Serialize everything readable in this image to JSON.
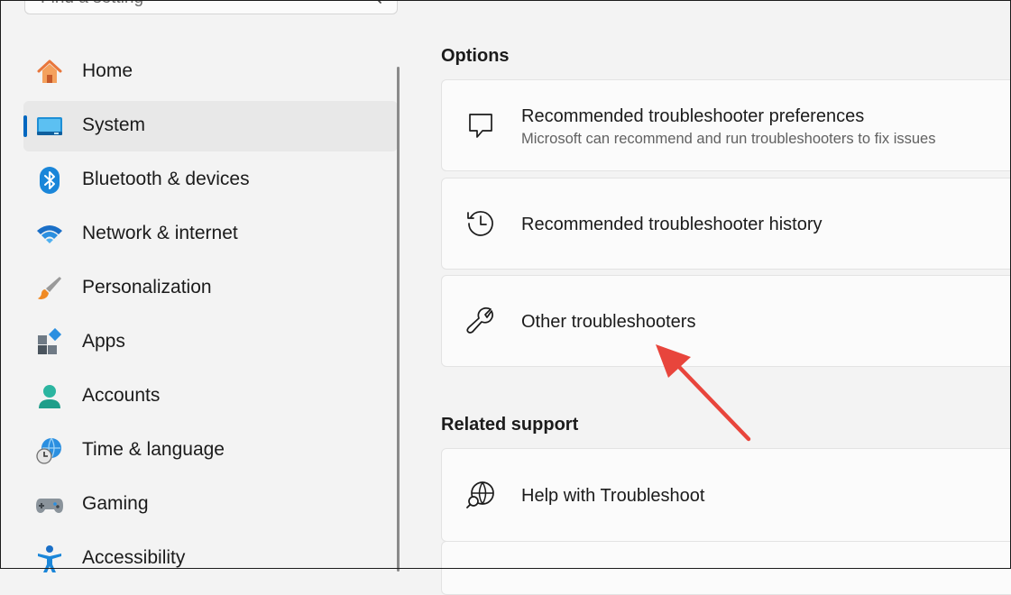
{
  "search": {
    "placeholder": "Find a setting"
  },
  "sidebar": {
    "items": [
      {
        "label": "Home",
        "icon": "home-icon"
      },
      {
        "label": "System",
        "icon": "system-icon",
        "selected": true
      },
      {
        "label": "Bluetooth & devices",
        "icon": "bluetooth-icon"
      },
      {
        "label": "Network & internet",
        "icon": "wifi-icon"
      },
      {
        "label": "Personalization",
        "icon": "paintbrush-icon"
      },
      {
        "label": "Apps",
        "icon": "apps-icon"
      },
      {
        "label": "Accounts",
        "icon": "account-icon"
      },
      {
        "label": "Time & language",
        "icon": "time-language-icon"
      },
      {
        "label": "Gaming",
        "icon": "gamepad-icon"
      },
      {
        "label": "Accessibility",
        "icon": "accessibility-icon"
      }
    ]
  },
  "options": {
    "title": "Options",
    "cards": [
      {
        "title": "Recommended troubleshooter preferences",
        "subtitle": "Microsoft can recommend and run troubleshooters to fix issues",
        "icon": "chat-bubble-icon"
      },
      {
        "title": "Recommended troubleshooter history",
        "icon": "history-icon"
      },
      {
        "title": "Other troubleshooters",
        "icon": "wrench-icon"
      }
    ]
  },
  "related": {
    "title": "Related support",
    "cards": [
      {
        "title": "Help with Troubleshoot",
        "icon": "globe-search-icon"
      }
    ]
  },
  "colors": {
    "accent": "#0067c0",
    "annotation_arrow": "#e8453c"
  }
}
